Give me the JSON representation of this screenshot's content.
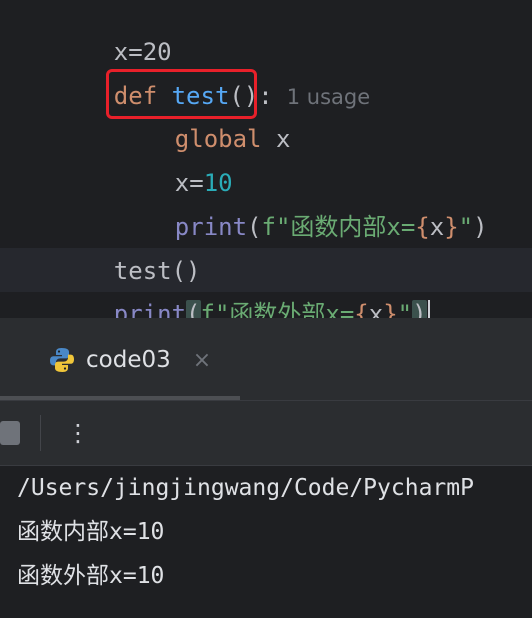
{
  "editor": {
    "line_partial": {
      "text": "x=20"
    },
    "def_line": {
      "kw": "def",
      "name": "test",
      "rest": "():",
      "hint": "1 usage"
    },
    "global_line": {
      "kw": "global",
      "name": "x"
    },
    "assign_line": {
      "var": "x",
      "op": "=",
      "value": "10"
    },
    "print_inner": {
      "fn": "print",
      "open": "(",
      "prefix": "f\"函数内部x=",
      "brace_open": "{",
      "var": "x",
      "brace_close": "}",
      "quote": "\"",
      "close": ")"
    },
    "call_line": {
      "text": "test()"
    },
    "print_outer": {
      "fn": "print",
      "open": "(",
      "prefix": "f\"函数外部x=",
      "brace_open": "{",
      "var": "x",
      "brace_close": "}",
      "quote": "\"",
      "close": ")"
    }
  },
  "run_panel": {
    "tab_label": "code03",
    "tab_close": "×",
    "more_label": "⋮",
    "output": [
      "/Users/jingjingwang/Code/PycharmP",
      "函数内部x=10",
      "函数外部x=10"
    ]
  },
  "colors": {
    "background": "#1e1f22",
    "keyword": "#cf8e6d",
    "function": "#56a8f5",
    "number": "#2aacb8",
    "string": "#6aab73",
    "builtin": "#8888c6",
    "highlight_box": "#e8202a"
  },
  "icons": {
    "tab": "python-icon",
    "close": "close-icon",
    "stop": "stop-icon",
    "more": "more-vertical-icon"
  }
}
